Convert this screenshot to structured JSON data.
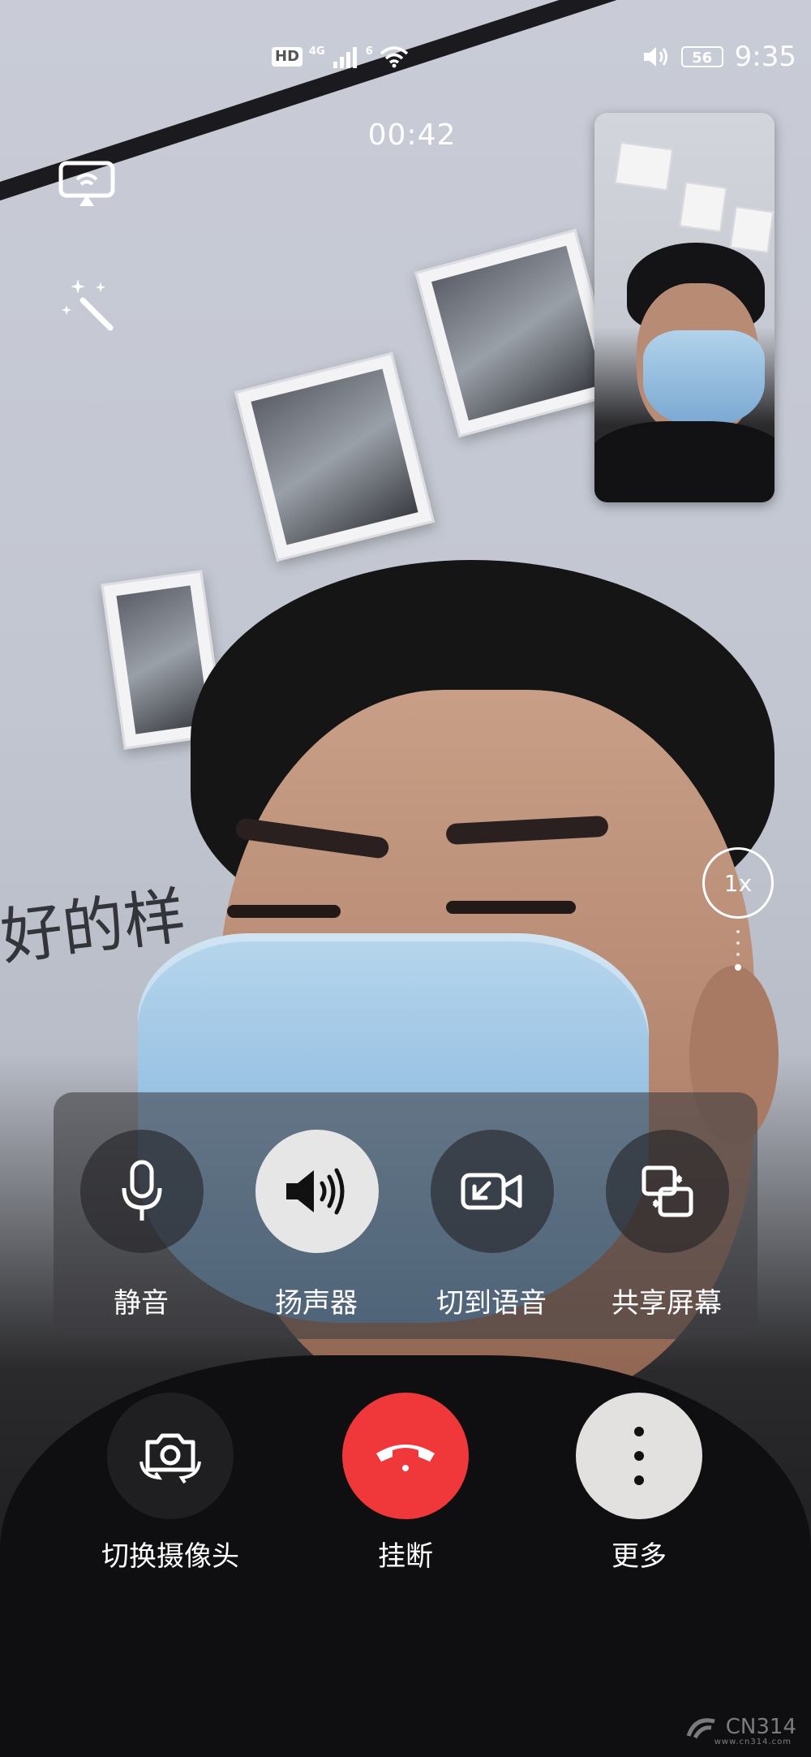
{
  "status_bar": {
    "hd_badge": "HD",
    "network_badge": "4G",
    "wifi_badge": "6",
    "battery": "56",
    "time": "9:35"
  },
  "call": {
    "timer": "00:42",
    "zoom_level": "1x"
  },
  "remote_video": {
    "wall_text": "好的样"
  },
  "controls": {
    "mute_label": "静音",
    "speaker_label": "扬声器",
    "switch_voice_label": "切到语音",
    "share_screen_label": "共享屏幕"
  },
  "bottom_actions": {
    "switch_camera_label": "切换摄像头",
    "hang_up_label": "挂断",
    "more_label": "更多"
  },
  "watermark": {
    "brand": "CN314",
    "sub": "www.cn314.com"
  },
  "colors": {
    "hang_up": "#f0383b",
    "active_button": "#e7e6e7",
    "more_button": "#e3e1e0"
  },
  "icons": {
    "cast": "screen-cast-icon",
    "beauty": "magic-wand-icon",
    "mute": "microphone-icon",
    "speaker": "speaker-icon",
    "voice": "video-to-voice-icon",
    "share": "share-screen-icon",
    "switch_camera": "camera-switch-icon",
    "hang_up": "phone-hangup-icon",
    "more": "more-vertical-icon"
  }
}
